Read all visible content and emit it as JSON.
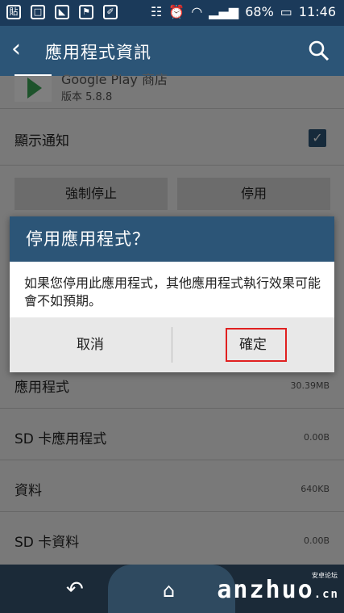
{
  "status": {
    "battery": "68%",
    "time": "11:46",
    "left_icons": [
      "貼",
      "□",
      "◣",
      "⚑",
      "✐"
    ]
  },
  "appbar": {
    "title": "應用程式資訊"
  },
  "app": {
    "name": "Google Play 商店",
    "version": "版本 5.8.8"
  },
  "settings": {
    "notifications_label": "顯示通知",
    "force_stop_label": "強制停止",
    "disable_label": "停用"
  },
  "storage": [
    {
      "label": "應用程式",
      "value": "30.39MB"
    },
    {
      "label": "SD 卡應用程式",
      "value": "0.00B"
    },
    {
      "label": "資料",
      "value": "640KB"
    },
    {
      "label": "SD 卡資料",
      "value": "0.00B"
    }
  ],
  "dialog": {
    "title": "停用應用程式？",
    "message": "如果您停用此應用程式，其他應用程式執行效果可能會不如預期。",
    "cancel_label": "取消",
    "ok_label": "確定"
  },
  "watermark": {
    "text": "anzhuo",
    "suffix": ".cn",
    "small": "安卓论坛"
  },
  "colors": {
    "appbar": "#2c5577",
    "statusbar": "#1b3a5a",
    "highlight": "#e02020"
  }
}
